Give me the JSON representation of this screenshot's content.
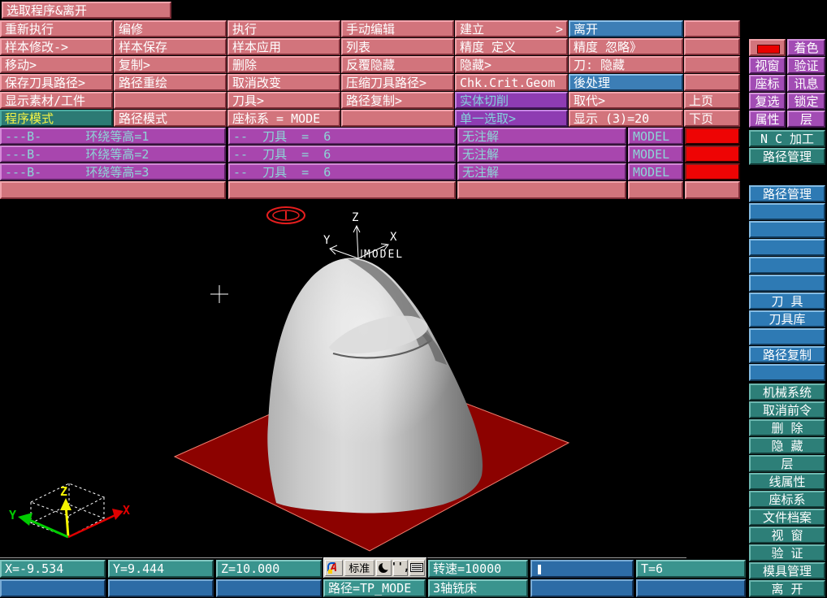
{
  "window_title": "选取程序&离开",
  "menu": {
    "rows": [
      [
        {
          "label": "重新执行"
        },
        {
          "label": "编修"
        },
        {
          "label": "执行"
        },
        {
          "label": "手动编辑"
        },
        {
          "label": "建立",
          "arrow": ">"
        },
        {
          "label": "离开",
          "style": "blue"
        },
        {
          "label": ""
        }
      ],
      [
        {
          "label": "样本修改->"
        },
        {
          "label": "样本保存"
        },
        {
          "label": "样本应用"
        },
        {
          "label": "列表"
        },
        {
          "label": "精度 定义"
        },
        {
          "label": "精度 忽略》"
        },
        {
          "label": ""
        }
      ],
      [
        {
          "label": "移动>"
        },
        {
          "label": "复制>"
        },
        {
          "label": "删除"
        },
        {
          "label": "反覆隐藏"
        },
        {
          "label": "隐藏>"
        },
        {
          "label": "刀: 隐藏"
        },
        {
          "label": ""
        }
      ],
      [
        {
          "label": "保存刀具路径>"
        },
        {
          "label": "路径重绘"
        },
        {
          "label": "取消改变"
        },
        {
          "label": "压缩刀具路径>"
        },
        {
          "label": "Chk.Crit.Geom"
        },
        {
          "label": "後处理",
          "style": "blue"
        },
        {
          "label": ""
        }
      ],
      [
        {
          "label": "显示素材/工件"
        },
        {
          "label": ""
        },
        {
          "label": "刀具>"
        },
        {
          "label": "路径复制>"
        },
        {
          "label": "实体切削",
          "style": "purple"
        },
        {
          "label": "取代>"
        },
        {
          "label": "上页"
        }
      ],
      [
        {
          "label": "程序模式",
          "style": "teal"
        },
        {
          "label": "路径模式"
        },
        {
          "label": "座标系 = MODE"
        },
        {
          "label": ""
        },
        {
          "label": "单一选取>",
          "style": "purple"
        },
        {
          "label": "显示 (3)=20"
        },
        {
          "label": "下页"
        }
      ]
    ]
  },
  "toolpaths": {
    "rows": [
      {
        "cells": [
          "---B-      环绕等高=1",
          "--  刀具  =  6",
          "无注解",
          "MODEL"
        ]
      },
      {
        "cells": [
          "---B-      环绕等高=2",
          "--  刀具  =  6",
          "无注解",
          "MODEL"
        ]
      },
      {
        "cells": [
          "---B-      环绕等高=3",
          "--  刀具  =  6",
          "无注解",
          "MODEL"
        ]
      }
    ]
  },
  "sidebar": {
    "top_pairs": [
      {
        "left": "",
        "right": "着色",
        "swatch": true
      },
      {
        "left": "视窗",
        "right": "验证"
      },
      {
        "left": "座标",
        "right": "讯息"
      },
      {
        "left": "复选",
        "right": "锁定"
      },
      {
        "left": "属性",
        "right": "层"
      }
    ],
    "wide": [
      "N C 加工",
      "路径管理"
    ],
    "blue": [
      "路径管理",
      "",
      "",
      "",
      "",
      "",
      "刀 具",
      "刀具库",
      "",
      "路径复制",
      ""
    ],
    "teal": [
      "机械系统",
      "取消前令",
      "删 除",
      "隐 藏",
      "层",
      "线属性",
      "座标系",
      "文件档案",
      "视 窗",
      "验 证",
      "模具管理",
      "离 开"
    ]
  },
  "status": {
    "row1": [
      "X=-9.534",
      "Y=9.444",
      "Z=10.000",
      "",
      "转速=10000",
      "",
      "T=6"
    ],
    "row2": [
      "",
      "",
      "",
      "路径=TP_MODE",
      "3轴铣床",
      "",
      ""
    ]
  },
  "ime": {
    "name_button": "标准",
    "punct": "'',"
  },
  "viewport": {
    "axis": {
      "x": "X",
      "y": "Y",
      "z": "Z",
      "origin": "MODEL"
    },
    "ucs": {
      "x": "X",
      "y": "Y",
      "z": "Z"
    }
  },
  "colors": {
    "menu_pink": "#d2747c",
    "highlight_blue": "#3c7eb6",
    "highlight_purple": "#8e3cb2",
    "selected_teal": "#2c7a74",
    "row_purple": "#a846ae",
    "alert_red": "#ee0404",
    "plate_red": "#8c0200"
  }
}
